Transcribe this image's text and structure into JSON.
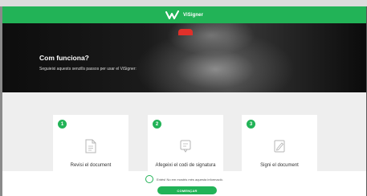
{
  "brand": {
    "name": "ViSigner",
    "color": "#22b357"
  },
  "hero": {
    "title": "Com funciona?",
    "subtitle": "Seguieixi aquests senzills passos per usar el ViSigner:"
  },
  "steps": [
    {
      "number": "1",
      "label": "Revisi el document",
      "icon": "document-icon"
    },
    {
      "number": "2",
      "label": "Afegeixi el codi de signatura",
      "icon": "code-icon"
    },
    {
      "number": "3",
      "label": "Signi el document",
      "icon": "sign-icon"
    }
  ],
  "footer": {
    "checkbox_label": "Entés! No em mostris més aquesta informació.",
    "button_label": "COMENÇAR"
  }
}
